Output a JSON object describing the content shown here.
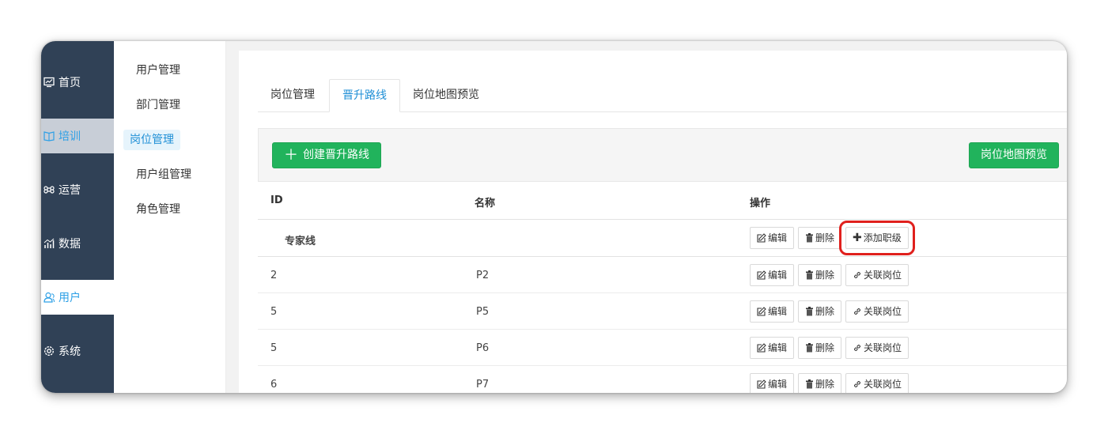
{
  "mainnav": [
    {
      "icon": "monitor-icon",
      "label": "首页"
    },
    {
      "icon": "book-icon",
      "label": "培训"
    },
    {
      "icon": "command-icon",
      "label": "运营"
    },
    {
      "icon": "chart-icon",
      "label": "数据"
    },
    {
      "icon": "user-icon",
      "label": "用户"
    },
    {
      "icon": "gear-icon",
      "label": "系统"
    }
  ],
  "subnav": [
    "用户管理",
    "部门管理",
    "岗位管理",
    "用户组管理",
    "角色管理"
  ],
  "tabs": [
    "岗位管理",
    "晋升路线",
    "岗位地图预览"
  ],
  "toolbar": {
    "create_label": "创建晋升路线",
    "map_preview_label": "岗位地图预览"
  },
  "table": {
    "headers": {
      "id": "ID",
      "name": "名称",
      "ops": "操作"
    },
    "group_name": "专家线",
    "rows": [
      {
        "id": "2",
        "name": "P2"
      },
      {
        "id": "5",
        "name": "P5"
      },
      {
        "id": "5",
        "name": "P6"
      },
      {
        "id": "6",
        "name": "P7"
      }
    ],
    "btn_edit": "编辑",
    "btn_delete": "删除",
    "btn_add_level": "添加职级",
    "btn_link_post": "关联岗位"
  },
  "colors": {
    "nav_bg": "#304156",
    "accent": "#1f8fd6",
    "green": "#21b35c",
    "highlight": "#e0201d"
  }
}
